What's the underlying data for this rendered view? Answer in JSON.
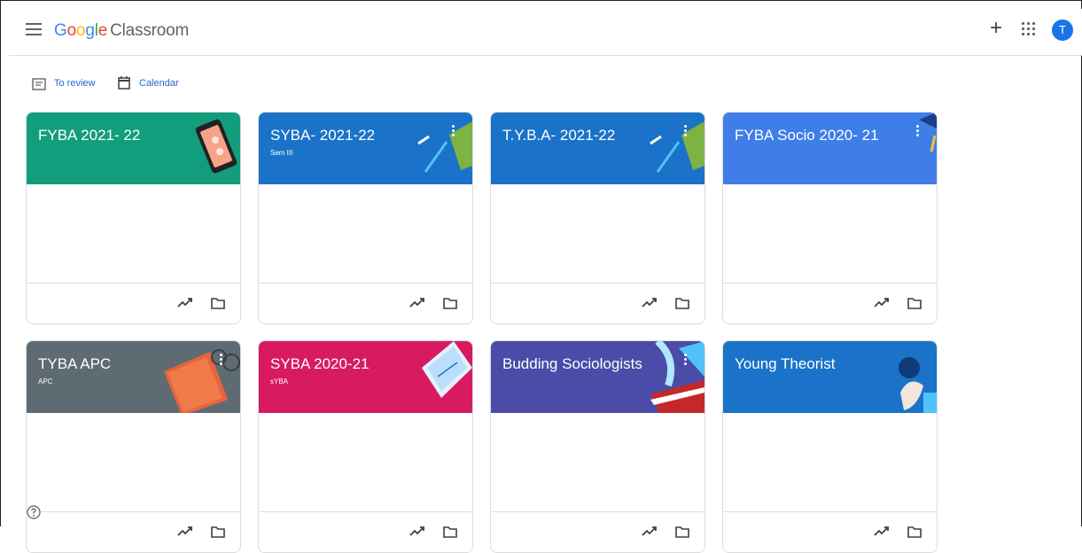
{
  "header": {
    "logo_letters": [
      "G",
      "o",
      "o",
      "g",
      "l",
      "e"
    ],
    "product": "Classroom",
    "avatar_letter": "T",
    "plus_label": "+"
  },
  "subnav": {
    "to_review": "To review",
    "calendar": "Calendar"
  },
  "classes": [
    {
      "title": "FYBA 2021- 22",
      "section": "",
      "color": "#129e7c"
    },
    {
      "title": "SYBA- 2021-22",
      "section": "Sem III",
      "color": "#1a73c8"
    },
    {
      "title": "T.Y.B.A- 2021-22",
      "section": "",
      "color": "#1a73c8"
    },
    {
      "title": "FYBA Socio 2020- 21",
      "section": "",
      "color": "#3f7ee8"
    },
    {
      "title": "TYBA APC",
      "section": "APC",
      "color": "#5f6b73"
    },
    {
      "title": "SYBA 2020-21",
      "section": "sYBA",
      "color": "#d81b60"
    },
    {
      "title": "Budding Sociologists",
      "section": "",
      "color": "#4a4ca8"
    },
    {
      "title": "Young Theorist",
      "section": "",
      "color": "#1a73c8"
    }
  ],
  "icons": {
    "menu": "menu-icon",
    "apps": "apps-grid-icon",
    "review": "review-list-icon",
    "calendar": "calendar-icon",
    "trend": "trending-up-icon",
    "folder": "folder-icon",
    "help": "help-icon"
  }
}
